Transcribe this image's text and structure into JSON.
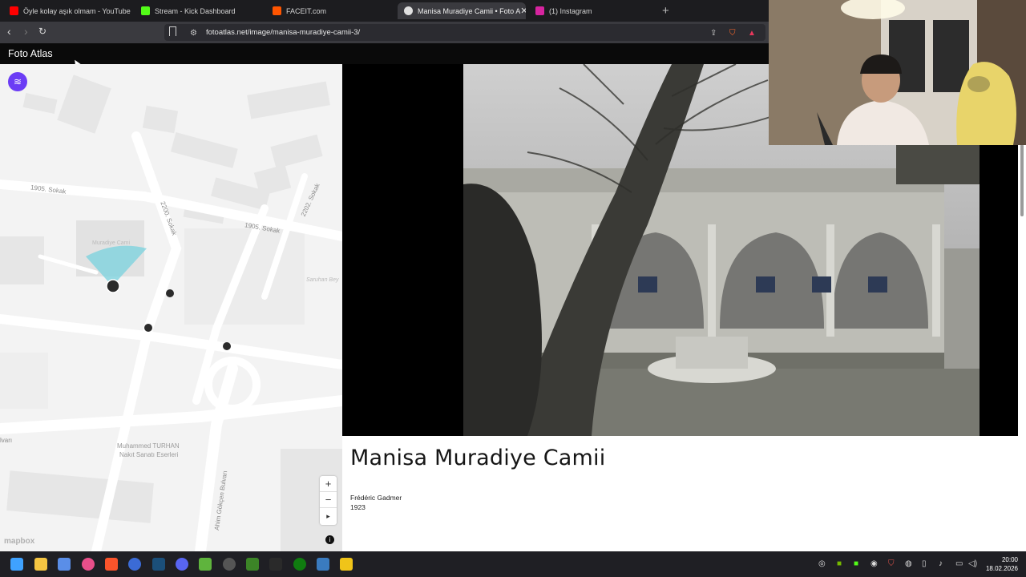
{
  "browser": {
    "tabs": [
      {
        "label": "Öyle kolay aşık olmam - YouTube",
        "icon": "youtube-icon",
        "color": "#ff0000"
      },
      {
        "label": "Stream - Kick Dashboard",
        "icon": "kick-icon",
        "color": "#53fc18"
      },
      {
        "label": "FACEIT.com",
        "icon": "faceit-icon",
        "color": "#ff5500"
      },
      {
        "label": "Manisa Muradiye Camii • Foto A",
        "icon": "fotoatlas-icon",
        "color": "#e0e0e0"
      },
      {
        "label": "(1) Instagram",
        "icon": "instagram-icon",
        "color": "#d6249f"
      }
    ],
    "url": "fotoatlas.net/image/manisa-muradiye-camii-3/"
  },
  "page": {
    "brand": "Foto Atlas",
    "map": {
      "streets": [
        "1905. Sokak",
        "2200. Sokak",
        "1905. Sokak",
        "2202. Sokak",
        "Muradiye Cami",
        "Saruhan Bey",
        "lvarı",
        "Muhammed TURHAN",
        "Nakıt Sanatı Eserleri",
        "Ahim Gökçen Bulvarı"
      ],
      "attribution": "mapbox",
      "zoom_in": "+",
      "zoom_out": "−",
      "compass": "▸",
      "info": "i",
      "layers": "≋"
    },
    "photo": {
      "title": "Manisa Muradiye Camii",
      "author": "Frédéric Gadmer",
      "year": "1923"
    }
  },
  "taskbar": {
    "time": "20:00",
    "date": "18.02.2026"
  },
  "colors": {
    "accent": "#6b3cf5",
    "viewcone": "#7fd3de"
  }
}
